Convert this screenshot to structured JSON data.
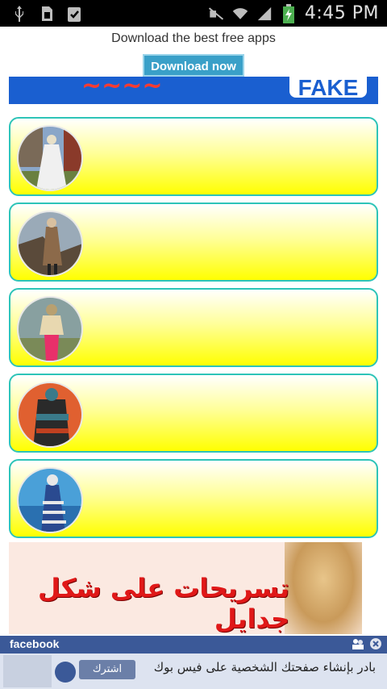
{
  "status_bar": {
    "time": "4:45 PM",
    "icons": [
      "usb-icon",
      "sim-icon",
      "clipboard-icon",
      "mute-icon",
      "wifi-icon",
      "signal-icon",
      "battery-charging-icon"
    ]
  },
  "promo": {
    "text": "Download the best free apps",
    "button_label": "Download now"
  },
  "top_banner": {
    "logo_text": "FAKE"
  },
  "list_items": [
    {
      "thumb_colors": [
        "#6b8fbf",
        "#f0f0f0",
        "#7a6040"
      ]
    },
    {
      "thumb_colors": [
        "#8c7a68",
        "#5a4a3a",
        "#3e3832"
      ]
    },
    {
      "thumb_colors": [
        "#b8a070",
        "#e8306a",
        "#7a8a58"
      ]
    },
    {
      "thumb_colors": [
        "#c04020",
        "#3a7a8a",
        "#1a1a1a"
      ]
    },
    {
      "thumb_colors": [
        "#4a90c8",
        "#2a4a90",
        "#e8e8e8"
      ]
    }
  ],
  "hair_banner": {
    "title": "تسريحات على شكل جدايل"
  },
  "facebook_ad": {
    "brand": "facebook",
    "message": "بادر بإنشاء صفحتك الشخصية على فيس بوك",
    "button_label": "اشترك"
  },
  "colors": {
    "card_border": "#2ec4b8",
    "card_yellow": "#ffff00",
    "promo_button": "#3aa0c8",
    "facebook_blue": "#3b5998"
  }
}
